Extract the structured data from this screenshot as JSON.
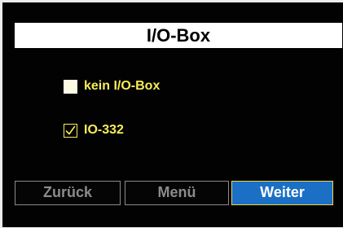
{
  "header": {
    "title": "I/O-Box"
  },
  "options": [
    {
      "label": "kein I/O-Box",
      "checked": false
    },
    {
      "label": "IO-332",
      "checked": true
    }
  ],
  "footer": {
    "back_label": "Zurück",
    "menu_label": "Menü",
    "next_label": "Weiter"
  },
  "colors": {
    "screen_background": "#020202",
    "option_text": "#f7ee57",
    "inactive_button": "#8b8b8b",
    "active_button_fill": "#1b6fc4",
    "active_button_border": "#f0d84a"
  },
  "icons": {
    "checked": "checkmark-icon"
  }
}
